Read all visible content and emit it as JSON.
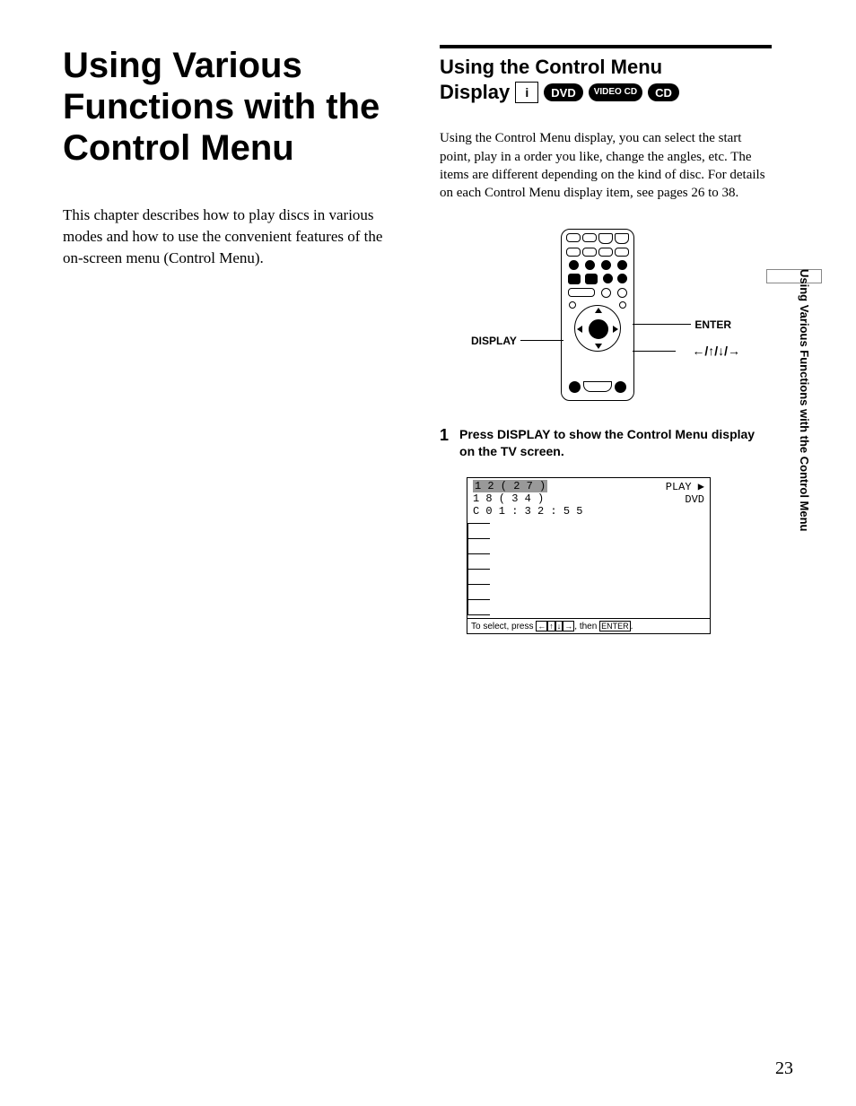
{
  "left": {
    "title": "Using Various Functions with the Control Menu",
    "intro": "This chapter describes how to play discs in various modes and how to use the convenient features of the on-screen menu (Control Menu)."
  },
  "right": {
    "section_title": "Using the Control Menu",
    "section_sub": "Display",
    "badges": {
      "remote": "i",
      "dvd": "DVD",
      "vcd": "VIDEO CD",
      "cd": "CD"
    },
    "body": "Using the Control Menu display, you can select the start point, play in a order you like, change the angles, etc. The items are different depending on the kind of disc. For details on each Control Menu display item, see pages 26 to 38.",
    "remote_labels": {
      "display": "DISPLAY",
      "enter": "ENTER",
      "arrows": "←/↑/↓/→"
    },
    "step1": {
      "num": "1",
      "text": "Press DISPLAY to show the Control Menu display on the TV screen."
    },
    "osd": {
      "hdr": "1 2 ( 2 7 )",
      "line2": "1 8 ( 3 4 )",
      "line3": "C  0 1 : 3 2 : 5 5",
      "play": "PLAY ▶",
      "dvd": "DVD",
      "hint_prefix": "To select, press ",
      "hint_keys": "← ↑ ↓ →",
      "hint_mid": ", then ",
      "hint_enter": "ENTER",
      "hint_suffix": "."
    }
  },
  "side_tab": "Using Various Functions with the Control Menu",
  "page_number": "23"
}
